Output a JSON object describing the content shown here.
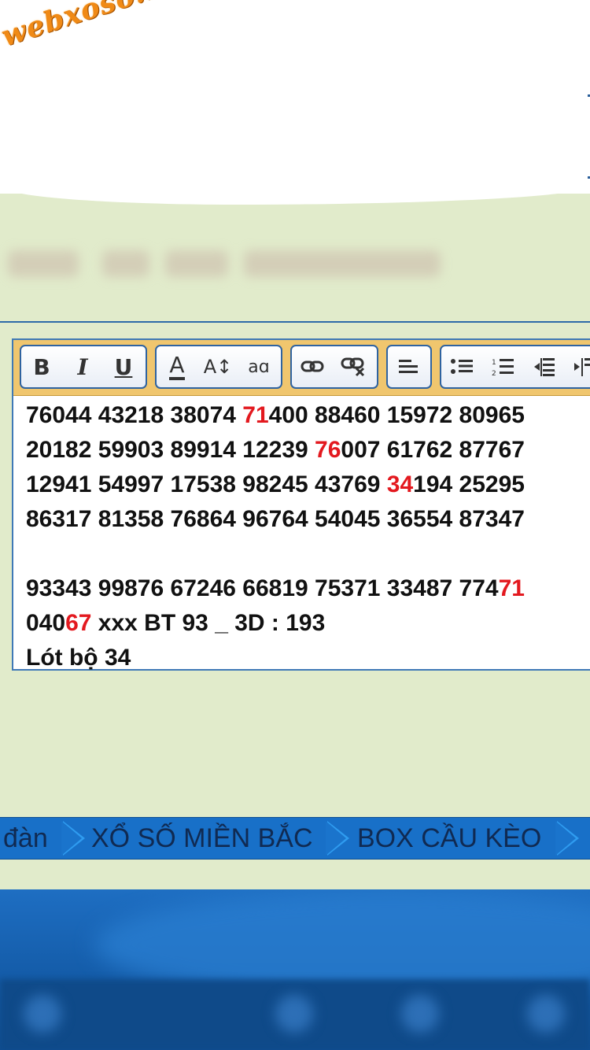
{
  "watermark": {
    "logo_text": "webxoso.net"
  },
  "toolbar": {
    "bold_label": "B",
    "italic_label": "I",
    "underline_label": "U",
    "font_color_label": "A",
    "font_size_label": "A↕",
    "font_case_label": "aɑ"
  },
  "editor": {
    "lines": [
      {
        "before": "76044 43218 38074 ",
        "hl": "71",
        "after": "400 88460 15972 80965"
      },
      {
        "before": "20182 59903 89914 12239 ",
        "hl": "76",
        "after": "007 61762 87767"
      },
      {
        "before": "12941 54997 17538 98245 43769 ",
        "hl": "34",
        "after": "194 25295"
      },
      {
        "before": "86317 81358 76864 96764 54045 36554 87347",
        "hl": "",
        "after": ""
      },
      {
        "before": "",
        "hl": "",
        "after": ""
      },
      {
        "before": "93343 99876 67246 66819 75371 33487 774",
        "hl": "71",
        "after": ""
      },
      {
        "before": "040",
        "hl": "67",
        "after": " xxx BT 93 _ 3D : 193"
      },
      {
        "before": "Lót bộ 34",
        "hl": "",
        "after": ""
      }
    ],
    "highlight_color": "#e3191f"
  },
  "nav": {
    "items": [
      {
        "label": "đàn"
      },
      {
        "label": "XỔ SỐ MIỀN BẮC"
      },
      {
        "label": "BOX CẦU KÈO"
      }
    ]
  }
}
